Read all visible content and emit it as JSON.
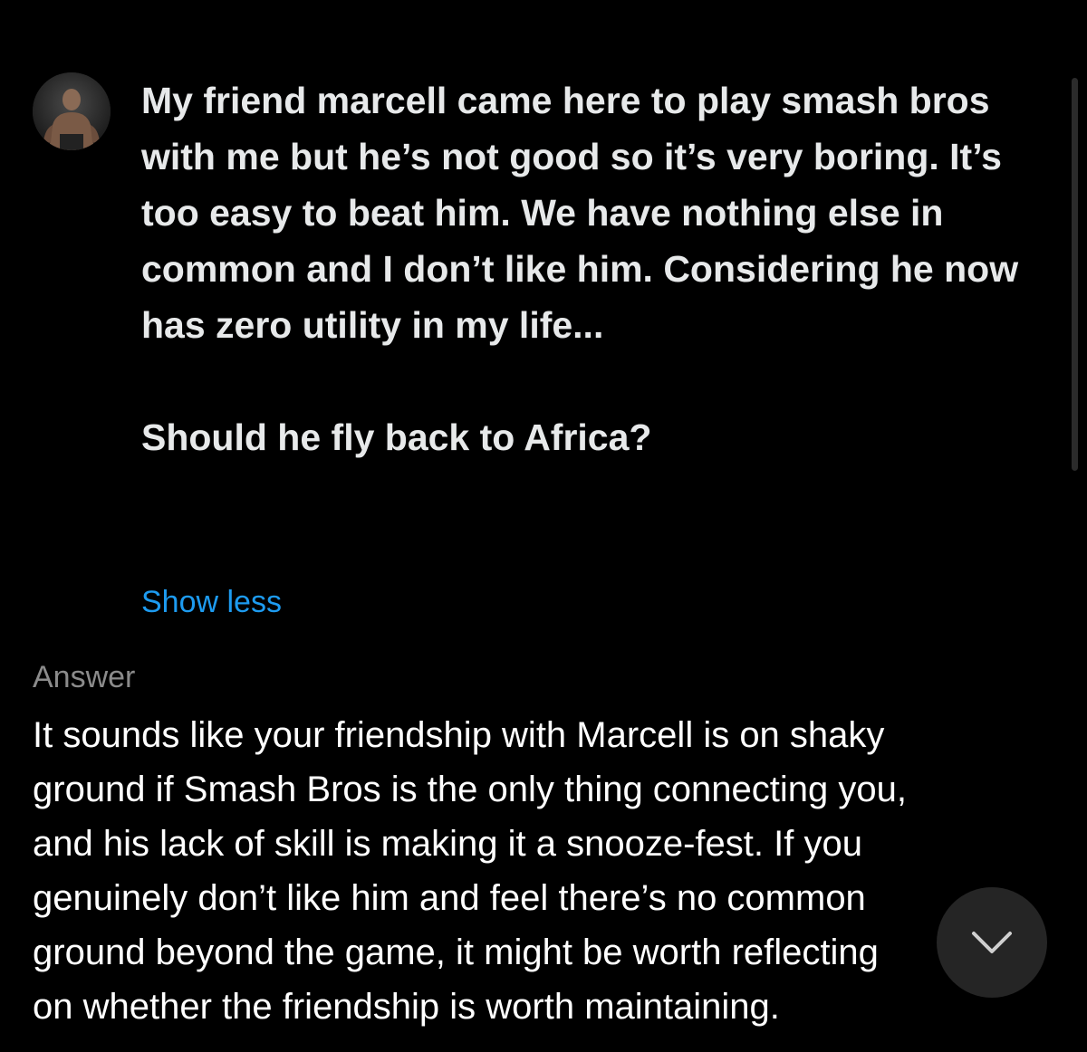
{
  "prompt": {
    "text": "My friend marcell came here to play smash bros with me but he’s not good so it’s very boring. It’s too easy to beat him. We have nothing else in common and I don’t like him. Considering he now has zero utility in my life...\n\nShould he fly back to Africa?",
    "show_less_label": "Show less"
  },
  "answer": {
    "label": "Answer",
    "lines": [
      "It sounds like your friendship with Marcell is on shaky",
      "ground if Smash Bros is the only thing connecting you,",
      "and his lack of skill is making it a snooze-fest. If you",
      "genuinely don’t like him and feel there’s no common",
      "ground beyond the game, it might be worth reflecting",
      "on whether the friendship is worth maintaining."
    ]
  },
  "icons": {
    "avatar": "user-avatar",
    "scroll_down": "chevron-down-icon"
  },
  "colors": {
    "background": "#000000",
    "text": "#e7e9ea",
    "link": "#1d9bf0",
    "muted": "#8b8b8b"
  }
}
